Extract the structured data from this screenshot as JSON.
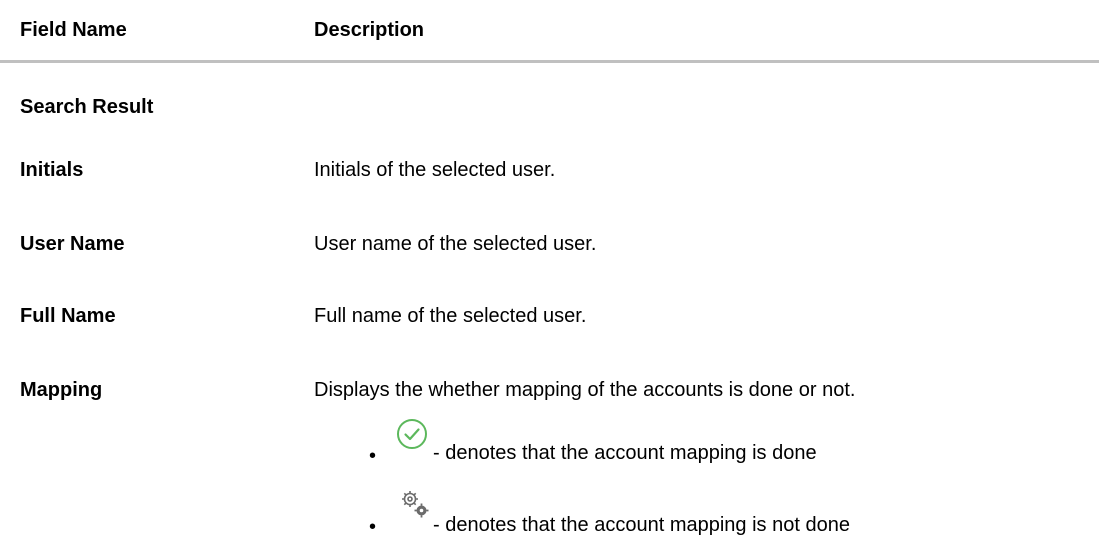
{
  "table": {
    "headers": {
      "field_name": "Field Name",
      "description": "Description"
    },
    "section_title": "Search Result",
    "rows": [
      {
        "field": "Initials",
        "description": "Initials of the selected user."
      },
      {
        "field": "User Name",
        "description": "User name of the selected user."
      },
      {
        "field": "Full Name",
        "description": "Full name of the selected user."
      },
      {
        "field": "Mapping",
        "description": "Displays the whether mapping of the accounts is done or not."
      }
    ],
    "mapping_bullets": [
      {
        "icon": "check-circle-icon",
        "text": "- denotes that the account mapping is done",
        "icon_color": "#5cb85c"
      },
      {
        "icon": "gears-icon",
        "text": "- denotes that the account mapping is not done",
        "icon_color": "#6b6b6b"
      }
    ]
  }
}
